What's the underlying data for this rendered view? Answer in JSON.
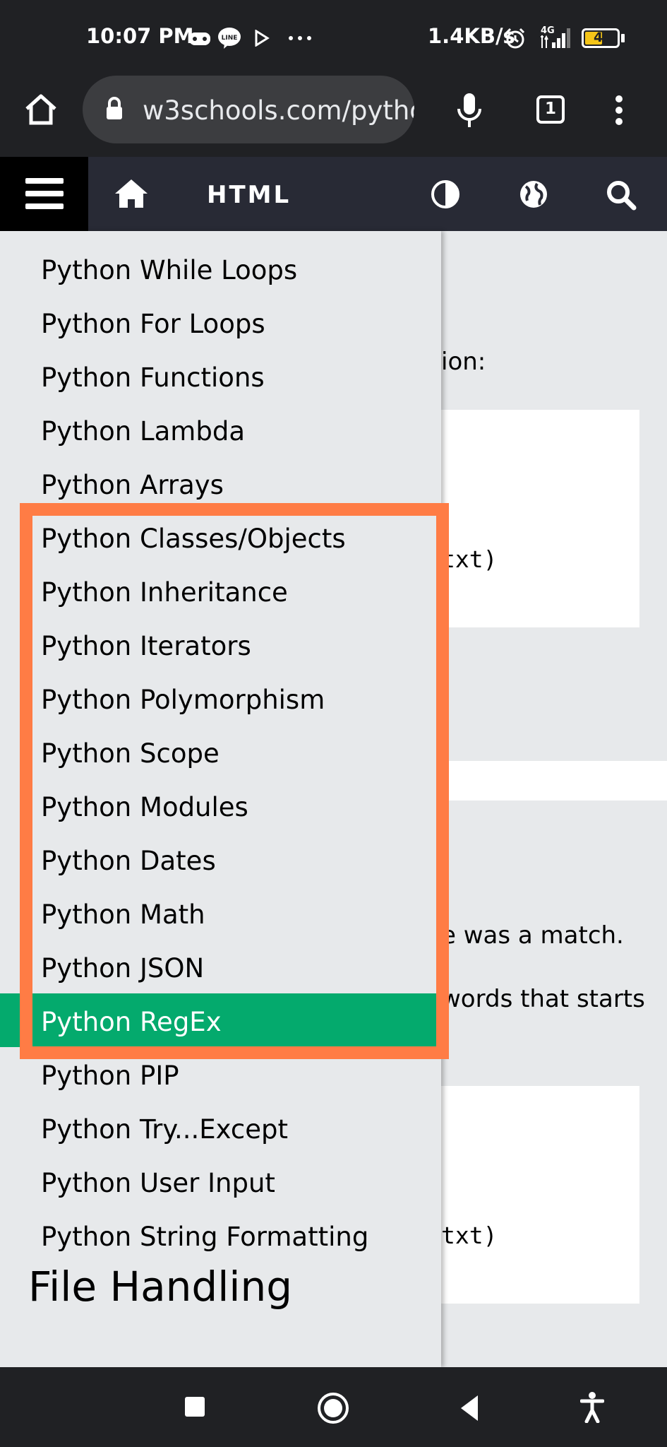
{
  "status_bar": {
    "time": "10:07 PM",
    "network_speed": "1.4KB/s",
    "network_type": "4G",
    "battery": "45"
  },
  "browser": {
    "url": "w3schools.com/pytho",
    "tab_count": "1"
  },
  "nav": {
    "section_label": "HTML"
  },
  "sidebar": {
    "items": [
      "Python While Loops",
      "Python For Loops",
      "Python Functions",
      "Python Lambda",
      "Python Arrays",
      "Python Classes/Objects",
      "Python Inheritance",
      "Python Iterators",
      "Python Polymorphism",
      "Python Scope",
      "Python Modules",
      "Python Dates",
      "Python Math",
      "Python JSON",
      "Python RegEx",
      "Python PIP",
      "Python Try...Except",
      "Python User Input",
      "Python String Formatting"
    ],
    "active_item": "Python RegEx",
    "section_heading": "File Handling"
  },
  "content": {
    "fragment_1": "ion:",
    "code_1": "txt)",
    "fragment_2": "e was a match.",
    "fragment_3": "words that starts",
    "code_2": "txt)"
  },
  "colors": {
    "active_green": "#04aa6d",
    "highlight_orange": "#ff7c45",
    "nav_bg": "#282a35"
  }
}
